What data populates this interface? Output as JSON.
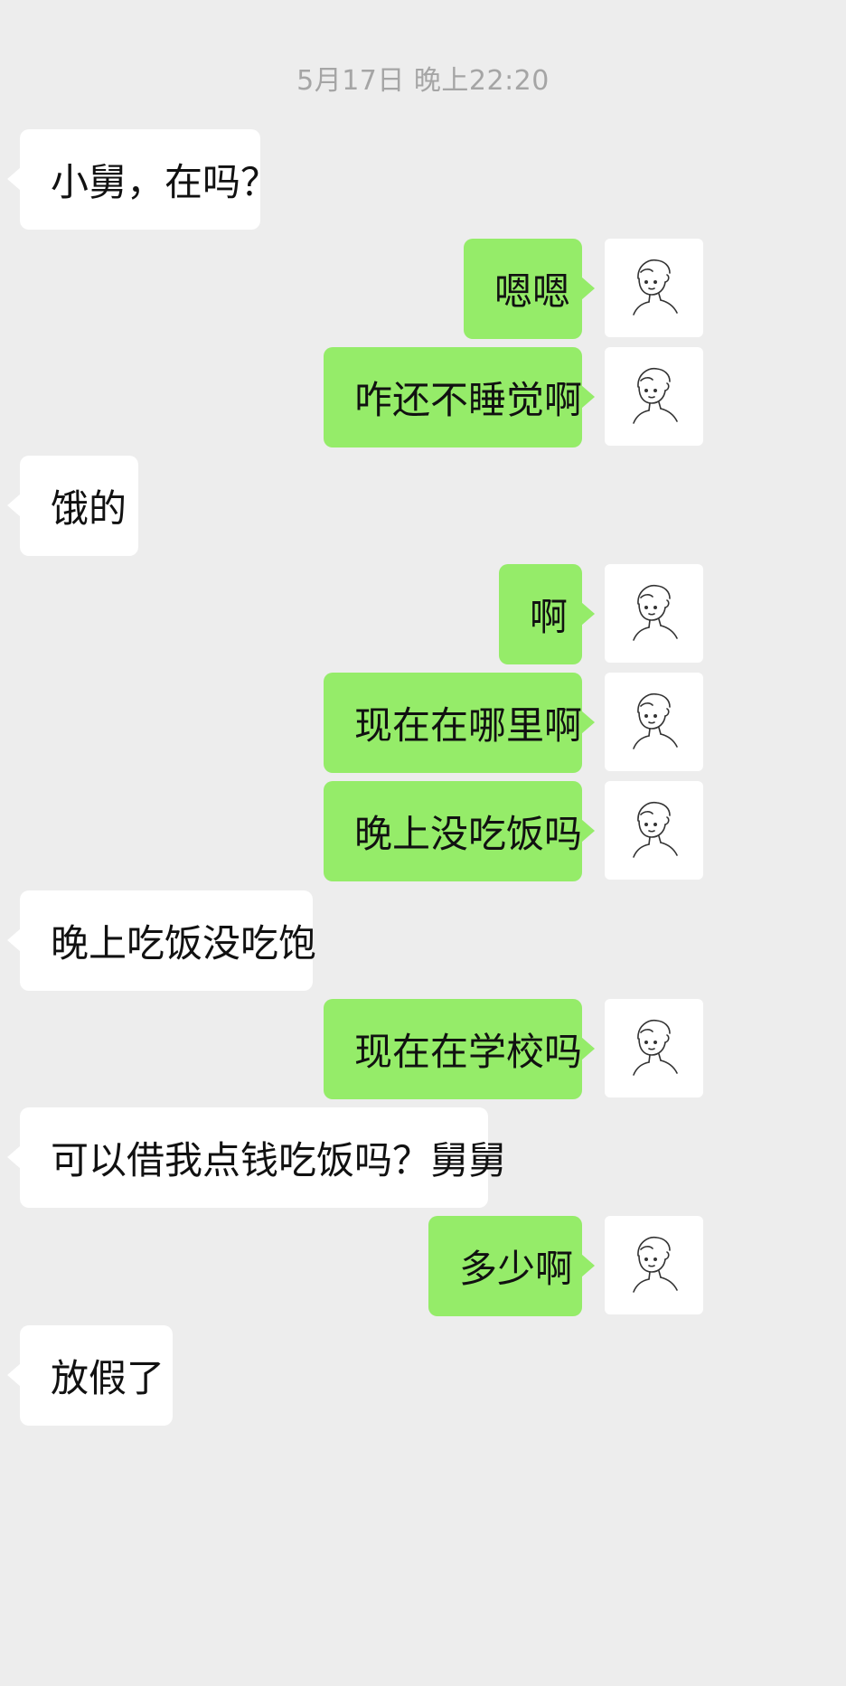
{
  "chat": {
    "timestamp": "5月17日 晚上22:20",
    "messages": [
      {
        "side": "left",
        "text": "小舅，在吗？"
      },
      {
        "side": "right",
        "text": "嗯嗯"
      },
      {
        "side": "right",
        "text": "咋还不睡觉啊"
      },
      {
        "side": "left",
        "text": "饿的"
      },
      {
        "side": "right",
        "text": "啊"
      },
      {
        "side": "right",
        "text": "现在在哪里啊"
      },
      {
        "side": "right",
        "text": "晚上没吃饭吗"
      },
      {
        "side": "left",
        "text": "晚上吃饭没吃饱"
      },
      {
        "side": "right",
        "text": "现在在学校吗"
      },
      {
        "side": "left",
        "text": "可以借我点钱吃饭吗？舅舅"
      },
      {
        "side": "right",
        "text": "多少啊"
      },
      {
        "side": "left",
        "text": "放假了"
      }
    ]
  },
  "colors": {
    "background": "#ededed",
    "incoming_bubble": "#ffffff",
    "outgoing_bubble": "#95ec69",
    "timestamp_text": "#a5a5a5"
  },
  "icons": {
    "self_avatar": "line-drawn-boy-avatar-icon"
  }
}
